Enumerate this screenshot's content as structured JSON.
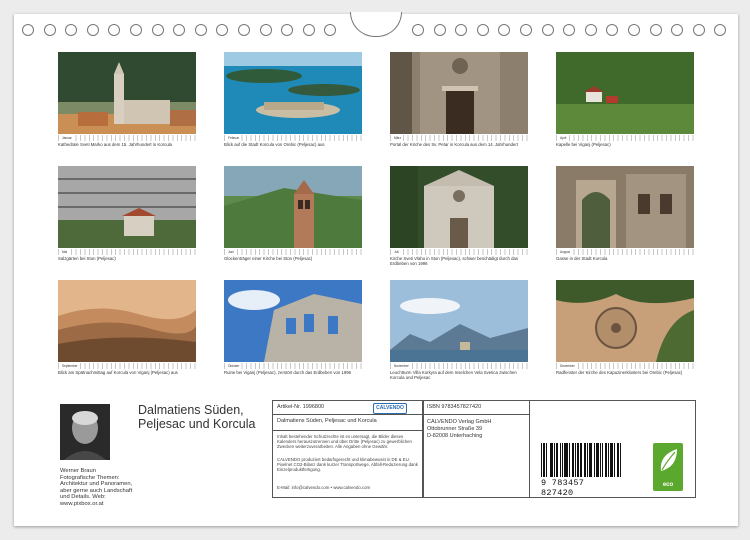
{
  "tiles": [
    {
      "month": "Januar",
      "caption": "Kathedrale Sveti Marko aus dem 15. Jahrhundert in Korcula"
    },
    {
      "month": "Februar",
      "caption": "Blick auf die Stadt Korcula von Orebic (Peljesac) aus"
    },
    {
      "month": "März",
      "caption": "Portal der Kirche des Sv. Petar in Korcula aus dem 14. Jahrhundert"
    },
    {
      "month": "April",
      "caption": "Kapelle bei Viganj (Peljesac)"
    },
    {
      "month": "Mai",
      "caption": "Salzgärten bei Ston (Peljesac)"
    },
    {
      "month": "Juni",
      "caption": "Glockenträger einer Kirche bei Ston (Peljesac)"
    },
    {
      "month": "Juli",
      "caption": "Kirche Sveti Vlaho in Ston (Peljesac), schwer beschädigt durch das Erdbeben von 1996"
    },
    {
      "month": "August",
      "caption": "Gasse in der Stadt Korcula"
    },
    {
      "month": "September",
      "caption": "Blick am Spätnachmittag auf Korcula von Viganj (Peljesac) aus"
    },
    {
      "month": "Oktober",
      "caption": "Ruine bei Viganj (Peljesac), zerstört durch das Erdbeben von 1996"
    },
    {
      "month": "November",
      "caption": "Leuchtturm Villa Korkyra auf dem Inselchen Vela Svetica zwischen Korcula und Peljesac"
    },
    {
      "month": "Dezember",
      "caption": "Radfenster der Kirche des Kapuzinerklosters bei Orebic (Peljesac)"
    }
  ],
  "author": {
    "name": "Werner Braun",
    "bio": "Fotografische Themen: Architektur und Panoramen, aber gerne auch Landschaft und Details. Web: www.pixbox.or.at"
  },
  "title": "Dalmatiens Süden, Peljesac und Korcula",
  "info": {
    "article": "Artikel-Nr. 1996800",
    "calvendo": "CALVENDO",
    "subtitle": "Dalmatiens Süden, Peljesac und Korcula",
    "rights": "Inhalt bestehender Schutzrechte ist es untersagt, die Bilder dieses Kalenders herauszutrennen und über Dritte (Peljesac) zu gewerblichen Zwecken weiterzuverarbeiten. Alle Angaben ohne Gewähr.",
    "production": "CALVENDO produziert bedarfsgerecht und klimabewusst in DE & EU. Pixelnet CO2-Bilanz dank kurzer Transportwege, Abfall-Reduzierung dank Einzelproduktfertigung.",
    "email": "E-Mail: info@calvendo.com • www.calvendo.com",
    "isbn": "ISBN 9783457827420",
    "publisher": [
      "CALVENDO Verlag GmbH",
      "Ottobrunner Straße 39",
      "D-82008 Unterhaching"
    ],
    "barcode_number": "9 783457 827420",
    "eco": "eco"
  },
  "colors": {
    "eco_green": "#5aa82e",
    "calvendo_blue": "#2a6cb0"
  }
}
